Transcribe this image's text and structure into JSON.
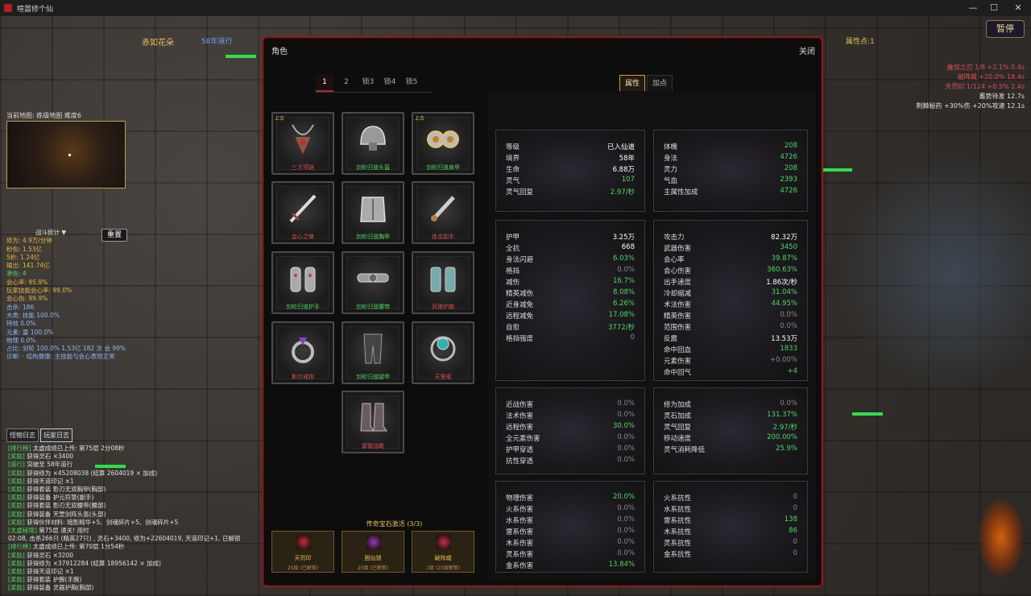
{
  "window": {
    "title": "喧嚣修个仙",
    "minimize": "—",
    "maximize": "☐",
    "close": "✕"
  },
  "hud": {
    "player_name": "赤如花朵",
    "era": "58年道行",
    "attr_points": "属性点:1",
    "pause_label": "暂停",
    "buffs": [
      {
        "text": "叠加之刃 1/8 +2.1% 0.4s",
        "color": "#e05050"
      },
      {
        "text": "破阵威 +20.0% 18.4s",
        "color": "#e05050"
      },
      {
        "text": "天罚印 1/124 +0.5% 2.4s",
        "color": "#e05050"
      },
      {
        "text": "蓄势待发 12.7s",
        "color": "#e0e0e0"
      },
      {
        "text": "荆棘秘药 +30%伤 +20%攻速 12.1s",
        "color": "#e0e0e0"
      }
    ],
    "map_label": "当前地图: 练级地图 难度6",
    "reset_label": "重置",
    "stats_header": "战斗统计 ▼",
    "stats": [
      {
        "text": "修为: 4.9万/分钟",
        "c": "l"
      },
      {
        "text": "秒伤: 1.53亿",
        "c": "l"
      },
      {
        "text": "5秒: 1.24亿",
        "c": "l"
      },
      {
        "text": "输出: 141.74亿",
        "c": "l"
      },
      {
        "text": "承伤: 4",
        "c": "lg"
      },
      {
        "text": "会心率: 95.9%",
        "c": "l"
      },
      {
        "text": "玩家技能会心率: 99.0%",
        "c": "l"
      },
      {
        "text": "会心伤: 99.9%",
        "c": "l"
      },
      {
        "text": "击杀: 186",
        "c": "lb"
      },
      {
        "text": "大类:   技能 100.0%",
        "c": "lb"
      },
      {
        "text": "          特效 0.0%",
        "c": "lb"
      },
      {
        "text": "元素:   雷 100.0%",
        "c": "lb"
      },
      {
        "text": "          物理 0.0%",
        "c": "lb"
      },
      {
        "text": "占比: 剑轮 100.0% 1.53亿 182 次 会 99%",
        "c": "lb"
      },
      {
        "text": "诊断: · 结构健康: 主技能与会心表现正常",
        "c": "lb"
      }
    ],
    "log_tabs": [
      "怪物日志",
      "玩家日志"
    ],
    "log": [
      {
        "tag": "[排行榜]",
        "text": " 太虚成绩已上传: 第75层 2分08秒"
      },
      {
        "tag": "[奖励]",
        "text": " 获得灵石 ×3400"
      },
      {
        "tag": "[道行]",
        "text": " 突破至 58年道行"
      },
      {
        "tag": "[奖励]",
        "text": " 获得修为 ×45208038 (结算 2604019 × 加成)"
      },
      {
        "tag": "[奖励]",
        "text": " 获得天道印记 ×1"
      },
      {
        "tag": "[奖励]",
        "text": " 获得套装 影刃无双胸甲(胸部)"
      },
      {
        "tag": "[奖励]",
        "text": " 获得装备 护元符箓(副手)"
      },
      {
        "tag": "[奖励]",
        "text": " 获得套装 影刃无双腰带(腰部)"
      },
      {
        "tag": "[奖励]",
        "text": " 获得装备 天罡剑阵头盔(头部)"
      },
      {
        "tag": "[奖励]",
        "text": " 获得伙伴材料: 暗影精华+5、剑魂碎片+5、剑魂碎片+5"
      },
      {
        "tag": "[太虚秘境]",
        "text": " 第75层 通关! 用时"
      },
      {
        "tag": "",
        "text": "02:08, 击杀266只 (精英27只) , 灵石+3400, 修为+22604019, 天道印记+1, 已解锁"
      },
      {
        "tag": "[排行榜]",
        "text": " 太虚成绩已上传: 第70层 1分54秒"
      },
      {
        "tag": "[奖励]",
        "text": " 获得灵石 ×3200"
      },
      {
        "tag": "[奖励]",
        "text": " 获得修为 ×37912284 (结算 18956142 × 加成)"
      },
      {
        "tag": "[奖励]",
        "text": " 获得天道印记 ×1"
      },
      {
        "tag": "[奖励]",
        "text": " 获得套装 护腕(手腕)"
      },
      {
        "tag": "[奖励]",
        "text": " 获得装备 灵器护胸(胸部)"
      }
    ]
  },
  "panel": {
    "title": "角色",
    "close_label": "关闭",
    "tabs": [
      "1",
      "2",
      "锁3",
      "锁4",
      "锁5"
    ],
    "right_tabs": [
      "属性",
      "加点"
    ],
    "equipment": [
      {
        "name": "三才项链",
        "tag": "上古",
        "color": "#e05050",
        "icon": "necklace"
      },
      {
        "name": "剑轮归道头盔",
        "tag": "",
        "color": "#4fd860",
        "icon": "helmet"
      },
      {
        "name": "剑轮归道肩甲",
        "tag": "上古",
        "color": "#4fd860",
        "icon": "shoulder"
      },
      {
        "name": "会心之锋",
        "tag": "",
        "color": "#e05050",
        "icon": "sword"
      },
      {
        "name": "剑轮归道胸甲",
        "tag": "",
        "color": "#4fd860",
        "icon": "chest"
      },
      {
        "name": "连击副手",
        "tag": "",
        "color": "#e05050",
        "icon": "dagger"
      },
      {
        "name": "剑轮归道护手",
        "tag": "",
        "color": "#4fd860",
        "icon": "gloves"
      },
      {
        "name": "剑轮归道腰带",
        "tag": "",
        "color": "#4fd860",
        "icon": "belt"
      },
      {
        "name": "风狼护腕",
        "tag": "",
        "color": "#e05050",
        "icon": "bracer"
      },
      {
        "name": "影刃戒指",
        "tag": "",
        "color": "#e05050",
        "icon": "ring"
      },
      {
        "name": "剑轮归道腿甲",
        "tag": "",
        "color": "#4fd860",
        "icon": "legs"
      },
      {
        "name": "天罡戒",
        "tag": "",
        "color": "#e05050",
        "icon": "ring2"
      },
      {
        "name": "雷霆战靴",
        "tag": "",
        "color": "#e05050",
        "icon": "boots"
      }
    ],
    "gem_title": "传奇宝石激活 (3/3)",
    "gems": [
      {
        "name": "天罚印",
        "sub": "25级 (已解锁)",
        "color": "#c03030"
      },
      {
        "name": "困仙锁",
        "sub": "25级 (已解锁)",
        "color": "#8a40c0"
      },
      {
        "name": "破阵威",
        "sub": "1级 (25级解锁)",
        "color": "#c03050"
      }
    ],
    "stat_boxes": [
      {
        "rows": [
          {
            "k": "等级",
            "v": "已入仙道",
            "c": "vw"
          },
          {
            "k": "境界",
            "v": "58年",
            "c": "vw"
          },
          {
            "k": "生命",
            "v": "6.88万",
            "c": "vw"
          },
          {
            "k": "灵气",
            "v": "107",
            "c": "vg"
          },
          {
            "k": "灵气回复",
            "v": "2.97/秒",
            "c": "vg"
          }
        ]
      },
      {
        "rows": [
          {
            "k": "体魄",
            "v": "208",
            "c": "vg"
          },
          {
            "k": "身法",
            "v": "4726",
            "c": "vg"
          },
          {
            "k": "灵力",
            "v": "208",
            "c": "vg"
          },
          {
            "k": "气血",
            "v": "2393",
            "c": "vg"
          },
          {
            "k": "主属性加成",
            "v": "4726",
            "c": "vg"
          }
        ]
      },
      {
        "rows": [
          {
            "k": "护甲",
            "v": "3.25万",
            "c": "vw"
          },
          {
            "k": "全抗",
            "v": "668",
            "c": "vw"
          },
          {
            "k": "身法闪避",
            "v": "6.03%",
            "c": "vg"
          },
          {
            "k": "格挡",
            "v": "0.0%",
            "c": "vd"
          },
          {
            "k": "减伤",
            "v": "16.7%",
            "c": "vg"
          },
          {
            "k": "精英减伤",
            "v": "8.08%",
            "c": "vg"
          },
          {
            "k": "近身减免",
            "v": "6.26%",
            "c": "vg"
          },
          {
            "k": "远程减免",
            "v": "17.08%",
            "c": "vg"
          },
          {
            "k": "自愈",
            "v": "3772/秒",
            "c": "vg"
          },
          {
            "k": "格挡强度",
            "v": "0",
            "c": "vd"
          }
        ]
      },
      {
        "rows": [
          {
            "k": "攻击力",
            "v": "82.32万",
            "c": "vw"
          },
          {
            "k": "武器伤害",
            "v": "3450",
            "c": "vg"
          },
          {
            "k": "会心率",
            "v": "39.87%",
            "c": "vg"
          },
          {
            "k": "会心伤害",
            "v": "360.63%",
            "c": "vg"
          },
          {
            "k": "出手速度",
            "v": "1.86次/秒",
            "c": "vw"
          },
          {
            "k": "冷却缩减",
            "v": "31.04%",
            "c": "vg"
          },
          {
            "k": "术法伤害",
            "v": "44.95%",
            "c": "vg"
          },
          {
            "k": "精英伤害",
            "v": "0.0%",
            "c": "vd"
          },
          {
            "k": "范围伤害",
            "v": "0.0%",
            "c": "vd"
          },
          {
            "k": "反震",
            "v": "13.53万",
            "c": "vw"
          },
          {
            "k": "命中回血",
            "v": "1833",
            "c": "vg"
          },
          {
            "k": "元素伤害",
            "v": "+0.00%",
            "c": "vd"
          },
          {
            "k": "命中回气",
            "v": "+4",
            "c": "vg"
          }
        ]
      },
      {
        "rows": [
          {
            "k": "近战伤害",
            "v": "0.0%",
            "c": "vd"
          },
          {
            "k": "法术伤害",
            "v": "0.0%",
            "c": "vd"
          },
          {
            "k": "远程伤害",
            "v": "30.0%",
            "c": "vg"
          },
          {
            "k": "全元素伤害",
            "v": "0.0%",
            "c": "vd"
          },
          {
            "k": "护甲穿透",
            "v": "0.0%",
            "c": "vd"
          },
          {
            "k": "抗性穿透",
            "v": "0.0%",
            "c": "vd"
          }
        ]
      },
      {
        "rows": [
          {
            "k": "修为加成",
            "v": "0.0%",
            "c": "vd"
          },
          {
            "k": "灵石加成",
            "v": "131.37%",
            "c": "vg"
          },
          {
            "k": "灵气回复",
            "v": "2.97/秒",
            "c": "vg"
          },
          {
            "k": "移动速度",
            "v": "200.00%",
            "c": "vg"
          },
          {
            "k": "灵气消耗降低",
            "v": "25.9%",
            "c": "vg"
          }
        ]
      },
      {
        "rows": [
          {
            "k": "物理伤害",
            "v": "20.0%",
            "c": "vg"
          },
          {
            "k": "火系伤害",
            "v": "0.0%",
            "c": "vd"
          },
          {
            "k": "水系伤害",
            "v": "0.0%",
            "c": "vd"
          },
          {
            "k": "雷系伤害",
            "v": "0.0%",
            "c": "vd"
          },
          {
            "k": "木系伤害",
            "v": "0.0%",
            "c": "vd"
          },
          {
            "k": "灵系伤害",
            "v": "0.0%",
            "c": "vd"
          },
          {
            "k": "金系伤害",
            "v": "13.84%",
            "c": "vg"
          }
        ]
      },
      {
        "rows": [
          {
            "k": "火系抗性",
            "v": "0",
            "c": "vd"
          },
          {
            "k": "水系抗性",
            "v": "0",
            "c": "vd"
          },
          {
            "k": "雷系抗性",
            "v": "138",
            "c": "vg"
          },
          {
            "k": "木系抗性",
            "v": "86",
            "c": "vg"
          },
          {
            "k": "灵系抗性",
            "v": "0",
            "c": "vd"
          },
          {
            "k": "金系抗性",
            "v": "0",
            "c": "vd"
          }
        ]
      }
    ]
  }
}
